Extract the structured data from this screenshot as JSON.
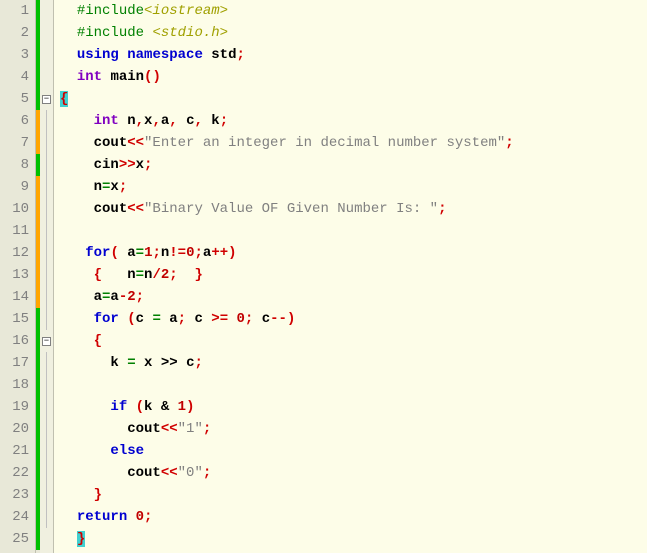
{
  "lines": {
    "1": "1",
    "2": "2",
    "3": "3",
    "4": "4",
    "5": "5",
    "6": "6",
    "7": "7",
    "8": "8",
    "9": "9",
    "10": "10",
    "11": "11",
    "12": "12",
    "13": "13",
    "14": "14",
    "15": "15",
    "16": "16",
    "17": "17",
    "18": "18",
    "19": "19",
    "20": "20",
    "21": "21",
    "22": "22",
    "23": "23",
    "24": "24",
    "25": "25"
  },
  "code": {
    "include1_pre": "#include",
    "include1_hdr": "<iostream>",
    "include2_pre": "#include ",
    "include2_hdr": "<stdio.h>",
    "using": "using",
    "namespace": "namespace",
    "std": "std",
    "semi": ";",
    "int": "int",
    "main": "main",
    "lparen": "(",
    "rparen": ")",
    "lbrace": "{",
    "rbrace": "}",
    "n": "n",
    "x": "x",
    "a": "a",
    "c": "c",
    "k": "k",
    "comma": ",",
    "cout": "cout",
    "cin": "cin",
    "ltlt": "<<",
    "gtgt": ">>",
    "str1": "\"Enter an integer in decimal number system\"",
    "str2": "\"Binary Value OF Given Number Is: \"",
    "str_1": "\"1\"",
    "str_0": "\"0\"",
    "eq": "=",
    "for": "for",
    "one": "1",
    "zero": "0",
    "two": "2",
    "neq": "!=",
    "pp": "++",
    "mm": "--",
    "div": "/",
    "minus": "-",
    "geq": " >= ",
    "shr": ">>",
    "if": "if",
    "else": "else",
    "amp": "&",
    "return": "return",
    "space": " "
  }
}
